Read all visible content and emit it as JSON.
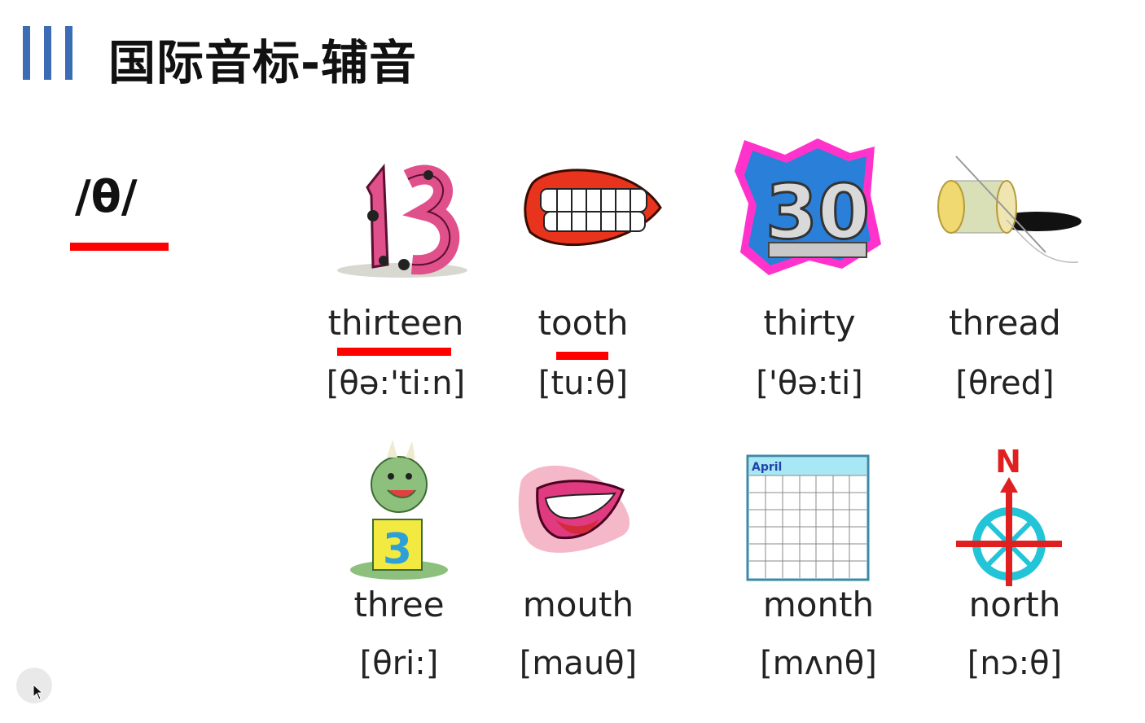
{
  "slide": {
    "title": "国际音标-辅音",
    "phoneme": "/θ/"
  },
  "words": [
    {
      "word": "thirteen",
      "ipa": "[θə:'ti:n]",
      "icon": "number-13-icon"
    },
    {
      "word": "tooth",
      "ipa": "[tu:θ]",
      "icon": "teeth-icon"
    },
    {
      "word": "thirty",
      "ipa": "['θə:ti]",
      "icon": "number-30-icon"
    },
    {
      "word": "thread",
      "ipa": "[θred]",
      "icon": "thread-spool-icon"
    },
    {
      "word": "three",
      "ipa": "[θri:]",
      "icon": "dragon-number-3-icon"
    },
    {
      "word": "mouth",
      "ipa": "[mauθ]",
      "icon": "mouth-icon"
    },
    {
      "word": "month",
      "ipa": "[mʌnθ]",
      "icon": "calendar-icon"
    },
    {
      "word": "north",
      "ipa": "[nɔ:θ]",
      "icon": "compass-north-icon"
    }
  ],
  "calendar": {
    "month": "April"
  },
  "compass": {
    "letter": "N"
  },
  "colors": {
    "accent_bar": "#3a6db3",
    "underline": "#ff0000"
  }
}
